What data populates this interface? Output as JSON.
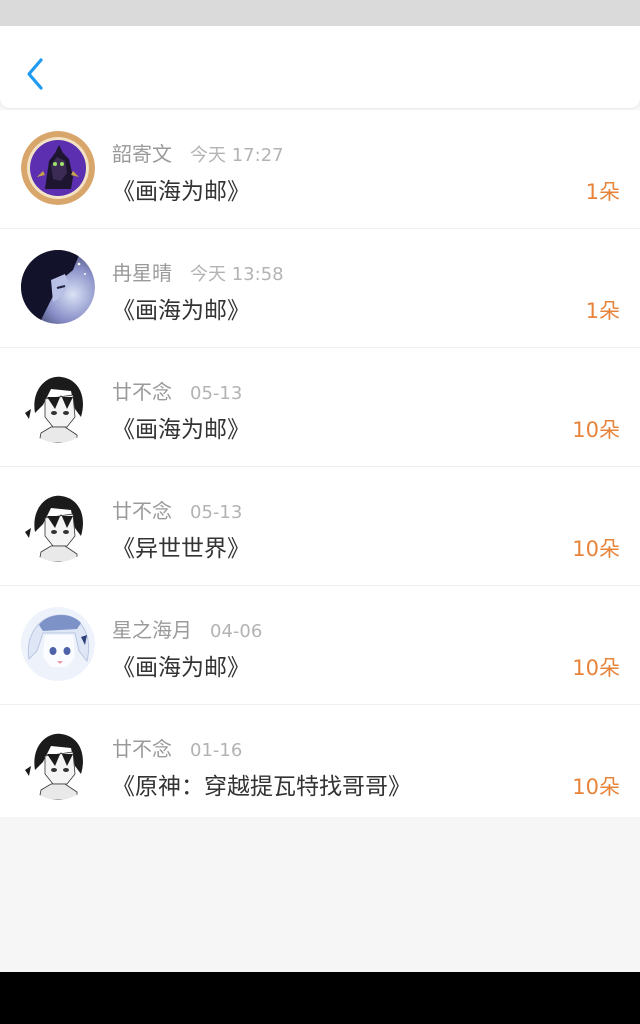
{
  "colors": {
    "accent_blue": "#1e9bf0",
    "count_orange": "#e8843a",
    "name_gray": "#9a9a9a",
    "title_dark": "#333333"
  },
  "header": {
    "back_icon": "chevron-left-icon"
  },
  "gifts": [
    {
      "name": "韶寄文",
      "time": "今天 17:27",
      "title": "《画海为邮》",
      "count": "1朵",
      "avatar": "dark-armored-figure-avatar"
    },
    {
      "name": "冉星晴",
      "time": "今天 13:58",
      "title": "《画海为邮》",
      "count": "1朵",
      "avatar": "dark-haired-boy-avatar"
    },
    {
      "name": "廿不念",
      "time": "05-13",
      "title": "《画海为邮》",
      "count": "10朵",
      "avatar": "sketch-girl-avatar"
    },
    {
      "name": "廿不念",
      "time": "05-13",
      "title": "《异世世界》",
      "count": "10朵",
      "avatar": "sketch-girl-avatar"
    },
    {
      "name": "星之海月",
      "time": "04-06",
      "title": "《画海为邮》",
      "count": "10朵",
      "avatar": "white-haired-girl-avatar"
    },
    {
      "name": "廿不念",
      "time": "01-16",
      "title": "《原神：穿越提瓦特找哥哥》",
      "count": "10朵",
      "avatar": "sketch-girl-avatar"
    }
  ]
}
